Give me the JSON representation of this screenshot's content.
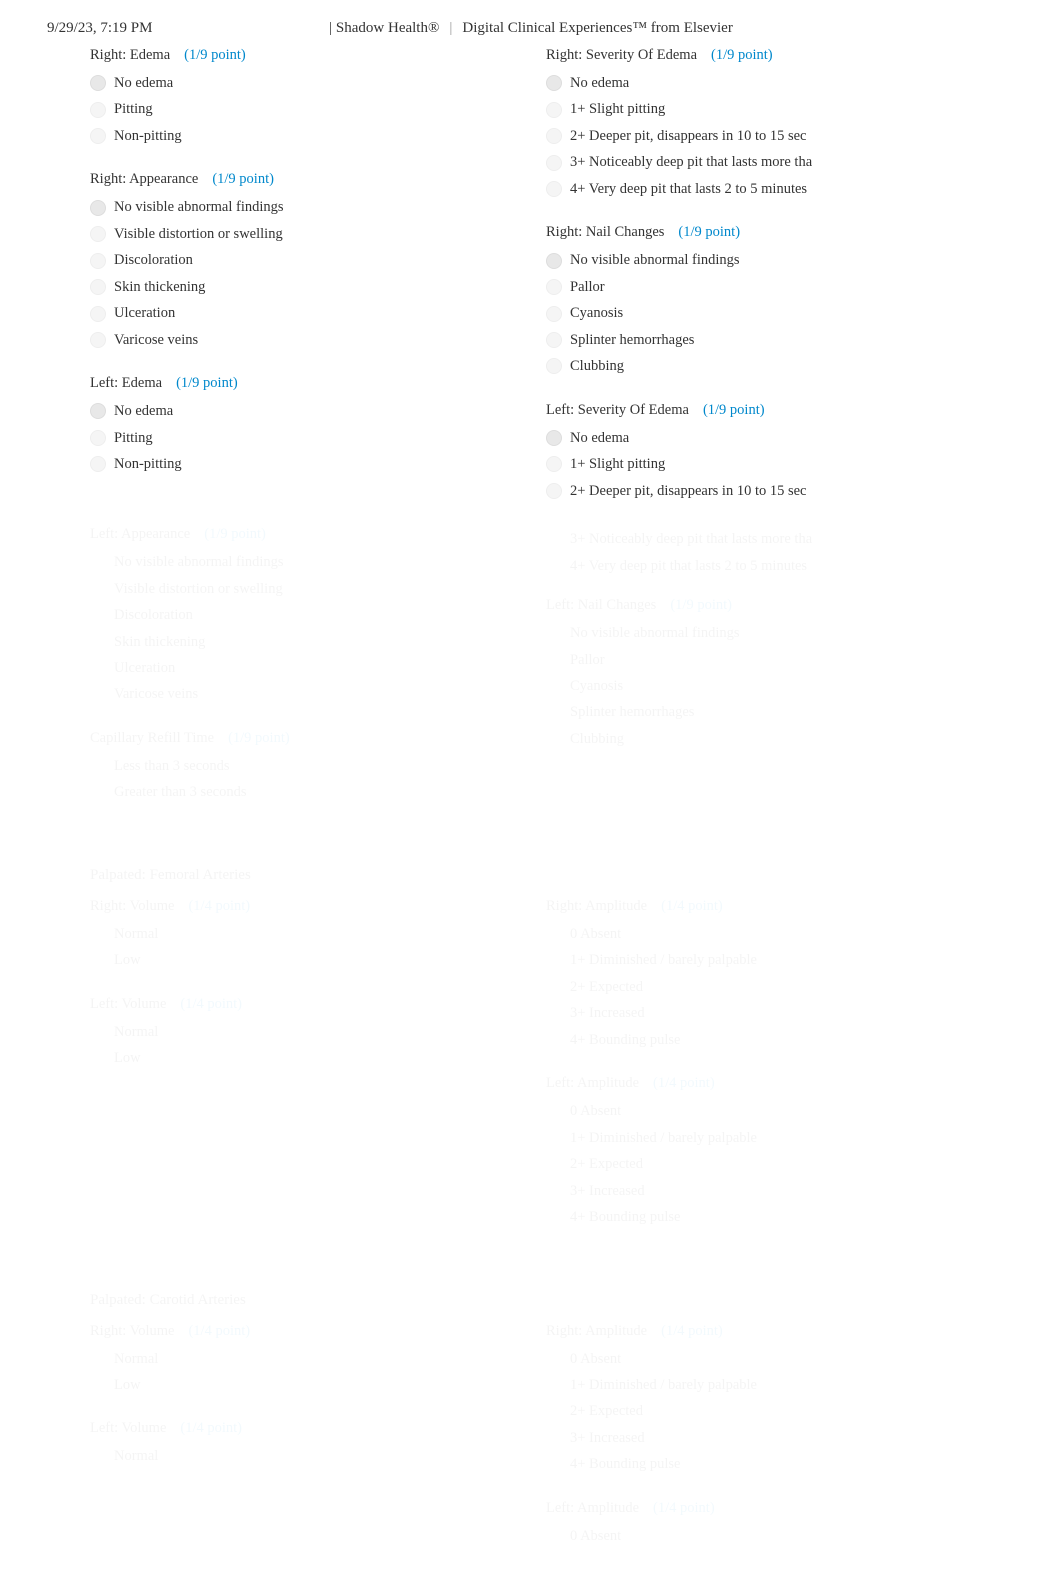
{
  "header": {
    "timestamp": "9/29/23, 7:19 PM",
    "brand": "| Shadow Health®",
    "divider": "|",
    "tagline": "Digital Clinical Experiences™ from Elsevier"
  },
  "visible_sections": {
    "left": [
      {
        "title": "Right: Edema",
        "points": "(1/9 point)",
        "options": [
          {
            "text": "No edema",
            "selected": true
          },
          {
            "text": "Pitting",
            "selected": false
          },
          {
            "text": "Non-pitting",
            "selected": false
          }
        ]
      },
      {
        "title": "Right: Appearance",
        "points": "(1/9 point)",
        "options": [
          {
            "text": "No visible abnormal findings",
            "selected": true
          },
          {
            "text": "Visible distortion or swelling",
            "selected": false
          },
          {
            "text": "Discoloration",
            "selected": false
          },
          {
            "text": "Skin thickening",
            "selected": false
          },
          {
            "text": "Ulceration",
            "selected": false
          },
          {
            "text": "Varicose veins",
            "selected": false
          }
        ]
      },
      {
        "title": "Left: Edema",
        "points": "(1/9 point)",
        "options": [
          {
            "text": "No edema",
            "selected": true
          },
          {
            "text": "Pitting",
            "selected": false
          },
          {
            "text": "Non-pitting",
            "selected": false
          }
        ]
      }
    ],
    "right": [
      {
        "title": "Right: Severity Of Edema",
        "points": "(1/9 point)",
        "options": [
          {
            "text": "No edema",
            "selected": true
          },
          {
            "text": "1+ Slight pitting",
            "selected": false
          },
          {
            "text": "2+ Deeper pit, disappears in 10 to 15 sec",
            "selected": false
          },
          {
            "text": "3+ Noticeably deep pit that lasts more tha",
            "selected": false
          },
          {
            "text": "4+ Very deep pit that lasts 2 to 5 minutes",
            "selected": false
          }
        ]
      },
      {
        "title": "Right: Nail Changes",
        "points": "(1/9 point)",
        "options": [
          {
            "text": "No visible abnormal findings",
            "selected": true
          },
          {
            "text": "Pallor",
            "selected": false
          },
          {
            "text": "Cyanosis",
            "selected": false
          },
          {
            "text": "Splinter hemorrhages",
            "selected": false
          },
          {
            "text": "Clubbing",
            "selected": false
          }
        ]
      },
      {
        "title": "Left: Severity Of Edema",
        "points": "(1/9 point)",
        "options": [
          {
            "text": "No edema",
            "selected": true
          },
          {
            "text": "1+ Slight pitting",
            "selected": false
          },
          {
            "text": "2+ Deeper pit, disappears in 10 to 15 sec",
            "selected": false
          }
        ]
      }
    ]
  },
  "faded_sections": {
    "block1": {
      "left": [
        {
          "title": "Left: Appearance",
          "points": "(1/9 point)",
          "options": [
            "No visible abnormal findings",
            "Visible distortion or swelling",
            "Discoloration",
            "Skin thickening",
            "Ulceration",
            "Varicose veins"
          ]
        },
        {
          "title": "Capillary Refill Time",
          "points": "(1/9 point)",
          "options": [
            "Less than 3 seconds",
            "Greater than 3 seconds"
          ]
        }
      ],
      "right": [
        {
          "extra_top": [
            "3+ Noticeably deep pit that lasts more tha",
            "4+ Very deep pit that lasts 2 to 5 minutes"
          ],
          "title": "Left: Nail Changes",
          "points": "(1/9 point)",
          "options": [
            "No visible abnormal findings",
            "Pallor",
            "Cyanosis",
            "Splinter hemorrhages",
            "Clubbing"
          ]
        }
      ]
    },
    "heading2": "Palpated: Femoral Arteries",
    "block2": {
      "left": [
        {
          "title": "Right: Volume",
          "points": "(1/4 point)",
          "options": [
            "Normal",
            "Low"
          ]
        },
        {
          "title": "Left: Volume",
          "points": "(1/4 point)",
          "options": [
            "Normal",
            "Low"
          ]
        }
      ],
      "right": [
        {
          "title": "Right: Amplitude",
          "points": "(1/4 point)",
          "options": [
            "0 Absent",
            "1+ Diminished / barely palpable",
            "2+ Expected",
            "3+ Increased",
            "4+ Bounding pulse"
          ]
        },
        {
          "title": "Left: Amplitude",
          "points": "(1/4 point)",
          "options": [
            "0 Absent",
            "1+ Diminished / barely palpable",
            "2+ Expected",
            "3+ Increased",
            "4+ Bounding pulse"
          ]
        }
      ]
    },
    "heading3": "Palpated: Carotid Arteries",
    "block3": {
      "left": [
        {
          "title": "Right: Volume",
          "points": "(1/4 point)",
          "options": [
            "Normal",
            "Low"
          ]
        },
        {
          "title": "Left: Volume",
          "points": "(1/4 point)",
          "options": [
            "Normal"
          ]
        }
      ],
      "right": [
        {
          "title": "Right: Amplitude",
          "points": "(1/4 point)",
          "options": [
            "0 Absent",
            "1+ Diminished / barely palpable",
            "2+ Expected",
            "3+ Increased",
            "4+ Bounding pulse"
          ]
        },
        {
          "title": "Left: Amplitude",
          "points": "(1/4 point)",
          "options": [
            "0 Absent"
          ]
        }
      ]
    }
  }
}
